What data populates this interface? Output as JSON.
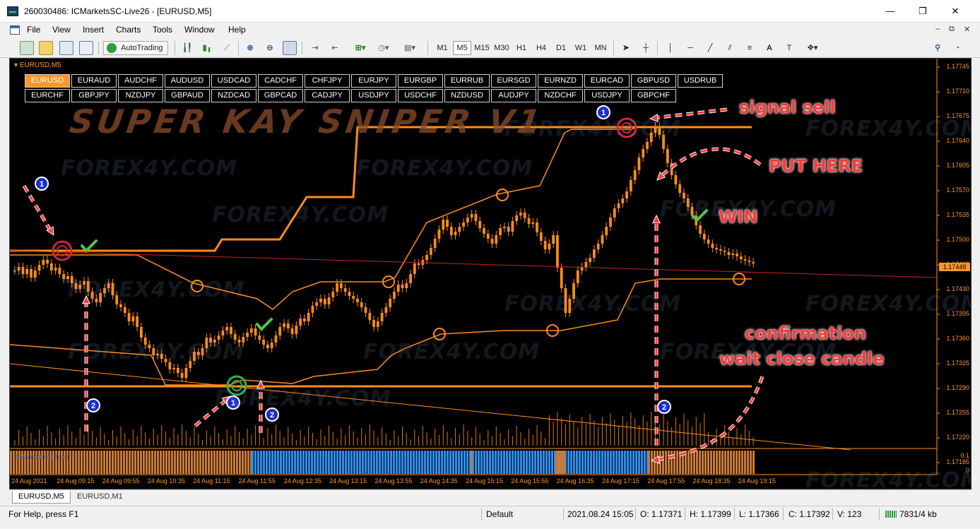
{
  "window": {
    "title": "260030486: ICMarketsSC-Live26 - [EURUSD,M5]",
    "minimize": "—",
    "maximize": "❐",
    "close": "✕"
  },
  "menu": {
    "items": [
      "File",
      "View",
      "Insert",
      "Charts",
      "Tools",
      "Window",
      "Help"
    ],
    "mdi_minimize": "‒",
    "mdi_restore": "⧉",
    "mdi_close": "✕"
  },
  "toolbar": {
    "autotrading_label": "AutoTrading",
    "timeframes": [
      "M1",
      "M5",
      "M15",
      "M30",
      "H1",
      "H4",
      "D1",
      "W1",
      "MN"
    ],
    "active_timeframe": "M5",
    "notification_count": "1"
  },
  "chart": {
    "title": "EURUSD,M5",
    "brand_text": "SUPER KAY SNIPER V1",
    "watermark_text": "FOREX4Y.COM",
    "pairs_row1": [
      "EURUSD",
      "EURAUD",
      "AUDCHF",
      "AUDUSD",
      "USDCAD",
      "CADCHF",
      "CHFJPY",
      "EURJPY",
      "EURGBP",
      "EURRUB",
      "EURSGD",
      "EURNZD",
      "EURCAD",
      "GBPUSD",
      "USDRUB"
    ],
    "pairs_row2": [
      "EURCHF",
      "GBPJPY",
      "NZDJPY",
      "GBPAUD",
      "NZDCAD",
      "GBPCAD",
      "CADJPY",
      "USDJPY",
      "USDCHF",
      "NZDUSD",
      "AUDJPY",
      "NZDCHF",
      "USDJPY",
      "GBPCHF"
    ],
    "active_pair": "EURUSD",
    "annotations": {
      "signal_sell": "signal sell",
      "put_here": "PUT HERE",
      "win": "WIN",
      "confirmation": "confirmation",
      "wait_close": "wait close candle"
    },
    "markers": [
      "1",
      "2"
    ],
    "indicator_label": "@MarketsFrost Trend",
    "indicator_scale": [
      "0.1",
      "0"
    ],
    "current_price": "1.17448",
    "price_levels": [
      "1.17745",
      "1.17710",
      "1.17675",
      "1.17640",
      "1.17605",
      "1.17570",
      "1.17535",
      "1.17500",
      "1.17465",
      "1.17430",
      "1.17395",
      "1.17360",
      "1.17325",
      "1.17290",
      "1.17255",
      "1.17220",
      "1.17185"
    ],
    "time_labels": [
      "24 Aug 2021",
      "24 Aug 09:15",
      "24 Aug 09:55",
      "24 Aug 10:35",
      "24 Aug 11:15",
      "24 Aug 11:55",
      "24 Aug 12:35",
      "24 Aug 13:15",
      "24 Aug 13:55",
      "24 Aug 14:35",
      "24 Aug 15:15",
      "24 Aug 15:55",
      "24 Aug 16:35",
      "24 Aug 17:15",
      "24 Aug 17:55",
      "24 Aug 18:35",
      "24 Aug 19:15"
    ],
    "colors": {
      "candle": "#ff8c1a",
      "channel": "#ff8c1a",
      "trend_red": "#d02020",
      "trend_blue": "#2b8ef0",
      "trend_orange": "#c87a38",
      "annotation": "#ff3b3b"
    }
  },
  "tabs": [
    "EURUSD,M5",
    "EURUSD,M1"
  ],
  "active_tab": "EURUSD,M5",
  "status": {
    "help": "For Help, press F1",
    "profile": "Default",
    "datetime": "2021.08.24 15:05",
    "open": "O: 1.17371",
    "high": "H: 1.17399",
    "low": "L: 1.17366",
    "close": "C: 1.17392",
    "volume": "V: 123",
    "traffic": "7831/4 kb"
  }
}
